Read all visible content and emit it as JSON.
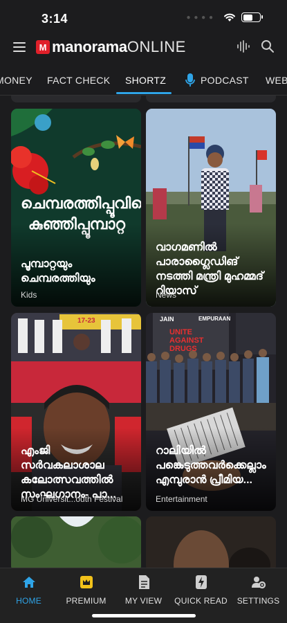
{
  "status": {
    "time": "3:14"
  },
  "header": {
    "logo_badge": "M",
    "logo_main": "manorama",
    "logo_sub": "ONLINE",
    "icons": [
      "menu-icon",
      "audio-waveform-icon",
      "search-icon"
    ]
  },
  "tabs": [
    {
      "label": "MONEY",
      "active": false
    },
    {
      "label": "FACT CHECK",
      "active": false
    },
    {
      "label": "SHORTZ",
      "active": true
    },
    {
      "label": "PODCAST",
      "active": false,
      "icon": "microphone-icon"
    },
    {
      "label": "WEB",
      "active": false
    }
  ],
  "cards": [
    {
      "title": "പൂമ്പാറ്റയും ചെമ്പരത്തിയും",
      "category": "Kids",
      "overlay_text": "ചെമ്പരത്തിപ്പൂവിലെ കുഞ്ഞിപ്പൂമ്പാറ്റ"
    },
    {
      "title": "വാഗമണിൽ പാരാഗ്ലൈഡിങ് നടത്തി മന്ത്രി മുഹമ്മദ് റിയാസ്",
      "category": "News"
    },
    {
      "title": "എംജി സർവകലാശാല കലോത്സവത്തിൽ സംഘഗാനം- പാ...",
      "category": "MG Universit...outh Festival",
      "overlay_text": "17-23"
    },
    {
      "title": "റാലിയിൽ പങ്കെടുത്തവർക്കെല്ലാം എമ്പുരാൻ പ്രീമിയ...",
      "category": "Entertainment",
      "overlay_text": "UNITE AGAINST DRUGS",
      "banner_brand": "JAIN",
      "banner_film": "EMPURAAN"
    }
  ],
  "bottom_nav": [
    {
      "label": "HOME",
      "icon": "home-icon",
      "active": true
    },
    {
      "label": "PREMIUM",
      "icon": "premium-icon",
      "active": false
    },
    {
      "label": "MY VIEW",
      "icon": "document-icon",
      "active": false
    },
    {
      "label": "QUICK READ",
      "icon": "flash-icon",
      "active": false
    },
    {
      "label": "SETTINGS",
      "icon": "settings-icon",
      "active": false
    }
  ],
  "colors": {
    "accent": "#2fa4e7",
    "brand": "#e0202a",
    "background": "#1c1c1e"
  }
}
